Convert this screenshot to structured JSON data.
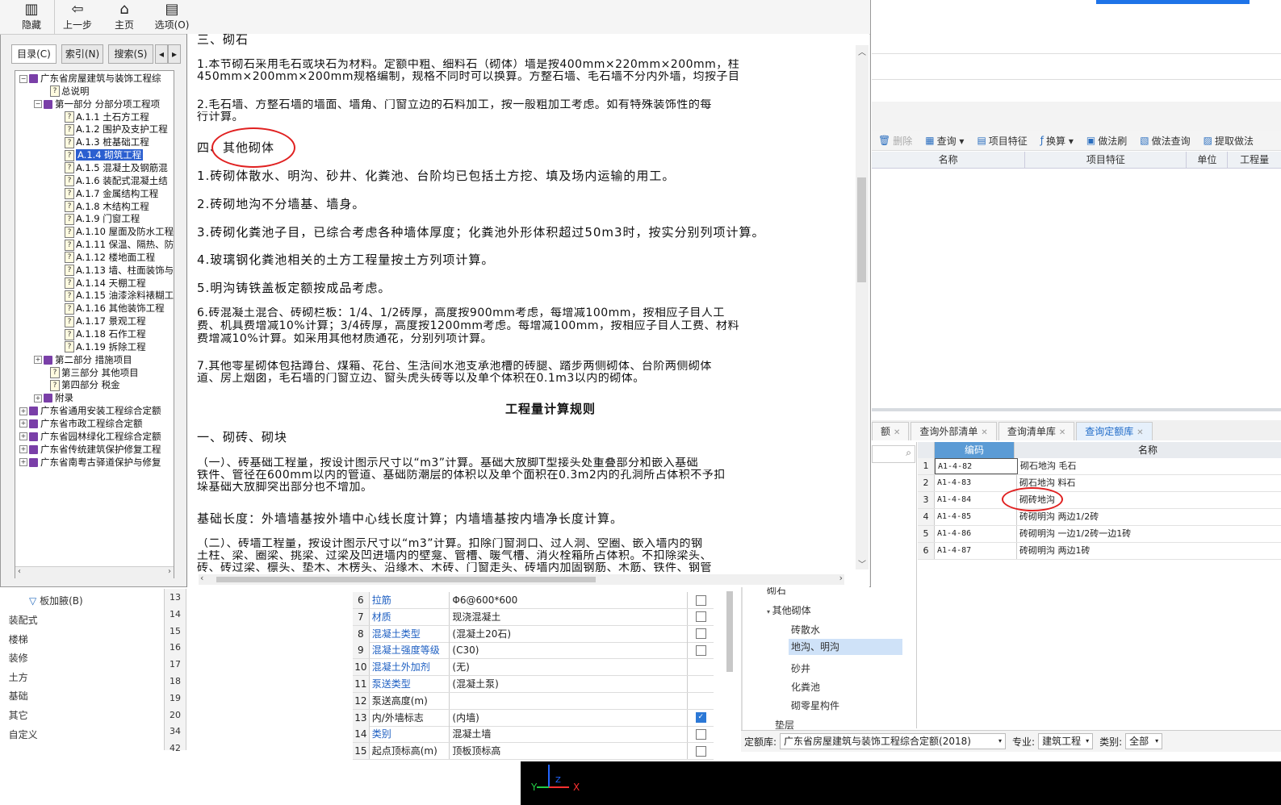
{
  "help_toolbar": {
    "hide": "隐藏",
    "back": "上一步",
    "home": "主页",
    "options": "选项(O)"
  },
  "help_tabs": [
    "目录(C)",
    "索引(N)",
    "搜索(S)"
  ],
  "tree": [
    {
      "t": "广东省房屋建筑与装饰工程综",
      "kind": "book",
      "pm": "−",
      "lvl": 0
    },
    {
      "t": "总说明",
      "kind": "page",
      "lvl": 2
    },
    {
      "t": "第一部分 分部分项工程项",
      "kind": "book",
      "pm": "−",
      "lvl": 1
    },
    {
      "t": "A.1.1 土石方工程",
      "kind": "page",
      "lvl": 3
    },
    {
      "t": "A.1.2 围护及支护工程",
      "kind": "page",
      "lvl": 3
    },
    {
      "t": "A.1.3 桩基础工程",
      "kind": "page",
      "lvl": 3
    },
    {
      "t": "A.1.4 砌筑工程",
      "kind": "page",
      "lvl": 3,
      "selected": true
    },
    {
      "t": "A.1.5 混凝土及钢筋混",
      "kind": "page",
      "lvl": 3
    },
    {
      "t": "A.1.6 装配式混凝土结",
      "kind": "page",
      "lvl": 3
    },
    {
      "t": "A.1.7 金属结构工程",
      "kind": "page",
      "lvl": 3
    },
    {
      "t": "A.1.8 木结构工程",
      "kind": "page",
      "lvl": 3
    },
    {
      "t": "A.1.9 门窗工程",
      "kind": "page",
      "lvl": 3
    },
    {
      "t": "A.1.10 屋面及防水工程",
      "kind": "page",
      "lvl": 3
    },
    {
      "t": "A.1.11 保温、隔热、防",
      "kind": "page",
      "lvl": 3
    },
    {
      "t": "A.1.12 楼地面工程",
      "kind": "page",
      "lvl": 3
    },
    {
      "t": "A.1.13 墙、柱面装饰与",
      "kind": "page",
      "lvl": 3
    },
    {
      "t": "A.1.14 天棚工程",
      "kind": "page",
      "lvl": 3
    },
    {
      "t": "A.1.15 油漆涂料裱糊工",
      "kind": "page",
      "lvl": 3
    },
    {
      "t": "A.1.16 其他装饰工程",
      "kind": "page",
      "lvl": 3
    },
    {
      "t": "A.1.17 景观工程",
      "kind": "page",
      "lvl": 3
    },
    {
      "t": "A.1.18 石作工程",
      "kind": "page",
      "lvl": 3
    },
    {
      "t": "A.1.19 拆除工程",
      "kind": "page",
      "lvl": 3
    },
    {
      "t": "第二部分 措施项目",
      "kind": "book",
      "pm": "+",
      "lvl": 1
    },
    {
      "t": "第三部分 其他项目",
      "kind": "page",
      "lvl": 2
    },
    {
      "t": "第四部分 税金",
      "kind": "page",
      "lvl": 2
    },
    {
      "t": "附录",
      "kind": "book",
      "pm": "+",
      "lvl": 1
    },
    {
      "t": "广东省通用安装工程综合定额",
      "kind": "book",
      "pm": "+",
      "lvl": 0
    },
    {
      "t": "广东省市政工程综合定额",
      "kind": "book",
      "pm": "+",
      "lvl": 0
    },
    {
      "t": "广东省园林绿化工程综合定额",
      "kind": "book",
      "pm": "+",
      "lvl": 0
    },
    {
      "t": "广东省传统建筑保护修复工程",
      "kind": "book",
      "pm": "+",
      "lvl": 0
    },
    {
      "t": "广东省南粤古驿道保护与修复",
      "kind": "book",
      "pm": "+",
      "lvl": 0
    }
  ],
  "content": {
    "l0": "三、砌石",
    "l1a": "1.本节砌石采用毛石或块石为材料。定额中粗、细料石（砌体）墙是按400mm×220mm×200mm，柱",
    "l1b": "450mm×200mm×200mm规格编制，规格不同时可以换算。方整石墙、毛石墙不分内外墙，均按子目",
    "l2a": "2.毛石墙、方整石墙的墙面、墙角、门窗立边的石料加工，按一般粗加工考虑。如有特殊装饰性的每",
    "l2b": "行计算。",
    "l3": "四、其他砌体",
    "l4": "1.砖砌体散水、明沟、砂井、化粪池、台阶均已包括土方挖、填及场内运输的用工。",
    "l5": "2.砖砌地沟不分墙基、墙身。",
    "l6": "3.砖砌化粪池子目，已综合考虑各种墙体厚度；化粪池外形体积超过50m3时，按实分别列项计算。",
    "l7": "4.玻璃钢化粪池相关的土方工程量按土方列项计算。",
    "l8": "5.明沟铸铁盖板定额按成品考虑。",
    "l9a": "6.砖混凝土混合、砖砌栏板：1/4、1/2砖厚，高度按900mm考虑，每增减100mm，按相应子目人工",
    "l9b": "费、机具费增减10%计算；3/4砖厚，高度按1200mm考虑。每增减100mm，按相应子目人工费、材料",
    "l9c": "费增减10%计算。如采用其他材质通花，分别列项计算。",
    "l10a": "7.其他零星砌体包括蹲台、煤箱、花台、生活间水池支承池槽的砖腿、踏步两侧砌体、台阶两侧砌体",
    "l10b": "道、房上烟囱，毛石墙的门窗立边、窗头虎头砖等以及单个体积在0.1m3以内的砌体。",
    "h1": "工程量计算规则",
    "l11": "一、砌砖、砌块",
    "l12a": "（一）、砖基础工程量，按设计图示尺寸以“m3”计算。基础大放脚T型接头处重叠部分和嵌入基础",
    "l12b": "铁件、管径在600mm以内的管道、基础防潮层的体积以及单个面积在0.3m2内的孔洞所占体积不予扣",
    "l12c": "垛基础大放脚突出部分也不增加。",
    "l13": "基础长度：外墙墙基按外墙中心线长度计算；内墙墙基按内墙净长度计算。",
    "l14a": "（二）、砖墙工程量，按设计图示尺寸以“m3”计算。扣除门窗洞口、过人洞、空圈、嵌入墙内的钢",
    "l14b": "土柱、梁、圈梁、挑梁、过梁及凹进墙内的壁龛、管槽、暖气槽、消火栓箱所占体积。不扣除梁头、",
    "l14c": "砖、砖过梁、檩头、垫木、木楞头、沿缘木、木砖、门窗走头、砖墙内加固钢筋、木筋、铁件、钢管"
  },
  "toolbar2": [
    {
      "icon": "delete-icon",
      "label": "删除",
      "dis": true
    },
    {
      "icon": "query-icon",
      "label": "查询 ▾"
    },
    {
      "icon": "feature-icon",
      "label": "项目特征"
    },
    {
      "icon": "fx-icon",
      "label": "换算 ▾"
    },
    {
      "icon": "method-brush-icon",
      "label": "做法刷"
    },
    {
      "icon": "method-query-icon",
      "label": "做法查询"
    },
    {
      "icon": "extract-icon",
      "label": "提取做法"
    }
  ],
  "colhdr": [
    "名称",
    "项目特征",
    "单位",
    "工程量"
  ],
  "tabs2": [
    {
      "label": "额",
      "x": true
    },
    {
      "label": "查询外部清单",
      "x": true
    },
    {
      "label": "查询清单库",
      "x": true
    },
    {
      "label": "查询定额库",
      "x": true,
      "active": true
    }
  ],
  "quota_grid": {
    "headers": [
      "编码",
      "名称"
    ],
    "rows": [
      {
        "n": "1",
        "code": "A1-4-82",
        "name": "砌石地沟 毛石"
      },
      {
        "n": "2",
        "code": "A1-4-83",
        "name": "砌石地沟 料石"
      },
      {
        "n": "3",
        "code": "A1-4-84",
        "name": "砌砖地沟"
      },
      {
        "n": "4",
        "code": "A1-4-85",
        "name": "砖砌明沟 两边1/2砖"
      },
      {
        "n": "5",
        "code": "A1-4-86",
        "name": "砖砌明沟 一边1/2砖一边1砖"
      },
      {
        "n": "6",
        "code": "A1-4-87",
        "name": "砖砌明沟 两边1砖"
      }
    ]
  },
  "quota_tree": {
    "a": "砌石",
    "b": "其他砌体",
    "c1": "砖散水",
    "c2": "地沟、明沟",
    "c3": "砂井",
    "c4": "化粪池",
    "c5": "砌零星构件",
    "d": "垫层"
  },
  "filterbar": {
    "lib_label": "定额库:",
    "lib_value": "广东省房屋建筑与装饰工程综合定额(2018)",
    "spec_label": "专业:",
    "spec_value": "建筑工程",
    "cat_label": "类别:",
    "cat_value": "全部"
  },
  "left_nav": {
    "board": "板加腋(B)",
    "items": [
      "装配式",
      "楼梯",
      "装修",
      "土方",
      "基础",
      "其它",
      "自定义"
    ]
  },
  "row_numbers": [
    "13",
    "14",
    "15",
    "16",
    "17",
    "18",
    "19",
    "20",
    "34",
    "42"
  ],
  "props": [
    {
      "n": "6",
      "k": "拉筋",
      "v": "Φ6@600*600",
      "blue": true,
      "cb": false
    },
    {
      "n": "7",
      "k": "材质",
      "v": "现浇混凝土",
      "blue": true,
      "cb": false
    },
    {
      "n": "8",
      "k": "混凝土类型",
      "v": "(混凝土20石)",
      "blue": true,
      "cb": false
    },
    {
      "n": "9",
      "k": "混凝土强度等级",
      "v": "(C30)",
      "blue": true,
      "cb": false
    },
    {
      "n": "10",
      "k": "混凝土外加剂",
      "v": "(无)",
      "blue": true,
      "cb": null
    },
    {
      "n": "11",
      "k": "泵送类型",
      "v": "(混凝土泵)",
      "blue": true,
      "cb": null
    },
    {
      "n": "12",
      "k": "泵送高度(m)",
      "v": "",
      "blue": false,
      "cb": null
    },
    {
      "n": "13",
      "k": "内/外墙标志",
      "v": "(内墙)",
      "blue": false,
      "cb": true
    },
    {
      "n": "14",
      "k": "类别",
      "v": "混凝土墙",
      "blue": true,
      "cb": false
    },
    {
      "n": "15",
      "k": "起点顶标高(m)",
      "v": "顶板顶标高",
      "blue": false,
      "cb": false
    }
  ],
  "axis": {
    "y": "Y",
    "z": "Z",
    "x": "X"
  }
}
